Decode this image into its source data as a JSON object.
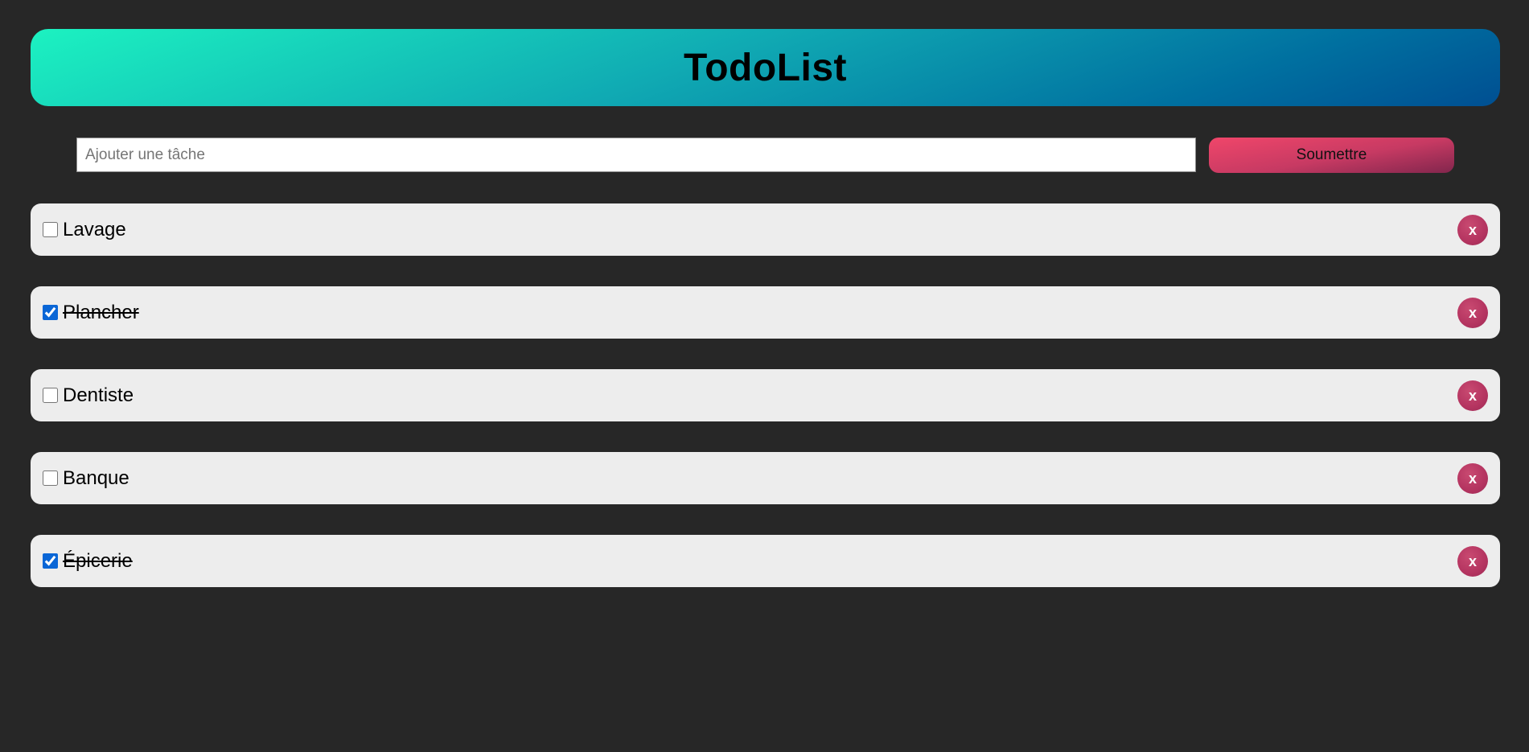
{
  "header": {
    "title": "TodoList"
  },
  "form": {
    "input_placeholder": "Ajouter une tâche",
    "input_value": "",
    "submit_label": "Soumettre"
  },
  "todos": [
    {
      "label": "Lavage",
      "checked": false,
      "delete_label": "x"
    },
    {
      "label": "Plancher",
      "checked": true,
      "delete_label": "x"
    },
    {
      "label": "Dentiste",
      "checked": false,
      "delete_label": "x"
    },
    {
      "label": "Banque",
      "checked": false,
      "delete_label": "x"
    },
    {
      "label": "Épicerie",
      "checked": true,
      "delete_label": "x"
    }
  ],
  "colors": {
    "background": "#272727",
    "header_gradient_start": "#1cf2c1",
    "header_gradient_end": "#004f92",
    "submit_gradient_start": "#f0466a",
    "submit_gradient_end": "#82264d",
    "delete_button": "#b43460",
    "item_background": "#ededed"
  }
}
